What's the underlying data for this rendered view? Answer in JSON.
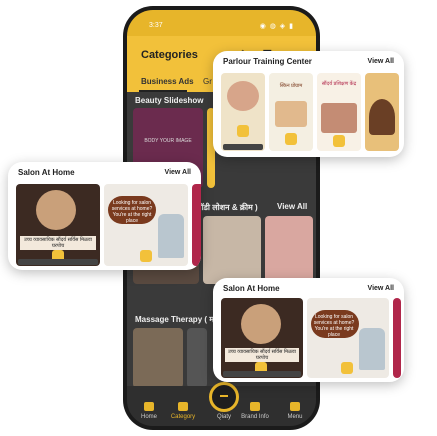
{
  "status_bar": {
    "time": "3:37",
    "indicators": "◉ ◍ ◈ ▮"
  },
  "app_bar": {
    "title": "Categories",
    "icons": "⇪ ☰ ○"
  },
  "tabs": [
    {
      "label": "Business Ads"
    },
    {
      "label": "Gr"
    }
  ],
  "sections": [
    {
      "title": "Beauty Slideshow"
    },
    {
      "title": "बॉडी लोशन & क्रीम )"
    },
    {
      "title": "Massage Therapy ( म"
    }
  ],
  "section_view_all": "View All",
  "bottom_nav": [
    {
      "label": "Home"
    },
    {
      "label": "Category"
    },
    {
      "label": "Qiaty"
    },
    {
      "label": "Brand Info"
    },
    {
      "label": "Menu"
    }
  ],
  "cards": {
    "parlour": {
      "title": "Parlour Training Center",
      "view_all": "View All",
      "posters": [
        {
          "caption": ""
        },
        {
          "caption": "स्किन प्रोग्राम"
        },
        {
          "caption": "सौंदर्य प्रशिक्षण केंद्र"
        },
        {
          "caption": ""
        }
      ]
    },
    "salon_left": {
      "title": "Salon At Home",
      "view_all": "View All",
      "poster_a": {
        "caption": "उच्च व्यावसायिक सौंदर्य सर्विस मिळवा घरपोच"
      },
      "poster_b": {
        "caption": "Looking for salon services at home? You're at the right place"
      }
    },
    "salon_right": {
      "title": "Salon At Home",
      "view_all": "View All",
      "poster_a": {
        "caption": "उच्च व्यावसायिक सौंदर्य सर्विस मिळवा घरपोच"
      },
      "poster_b": {
        "caption": "Looking for salon services at home? You're at the right place"
      }
    }
  },
  "thumbs": {
    "beauty_main": "BODY YOUR IMAGE"
  },
  "colors": {
    "accent": "#f2c13a",
    "dark": "#2b2b2b",
    "poster_brown": "#7a3a1e"
  }
}
